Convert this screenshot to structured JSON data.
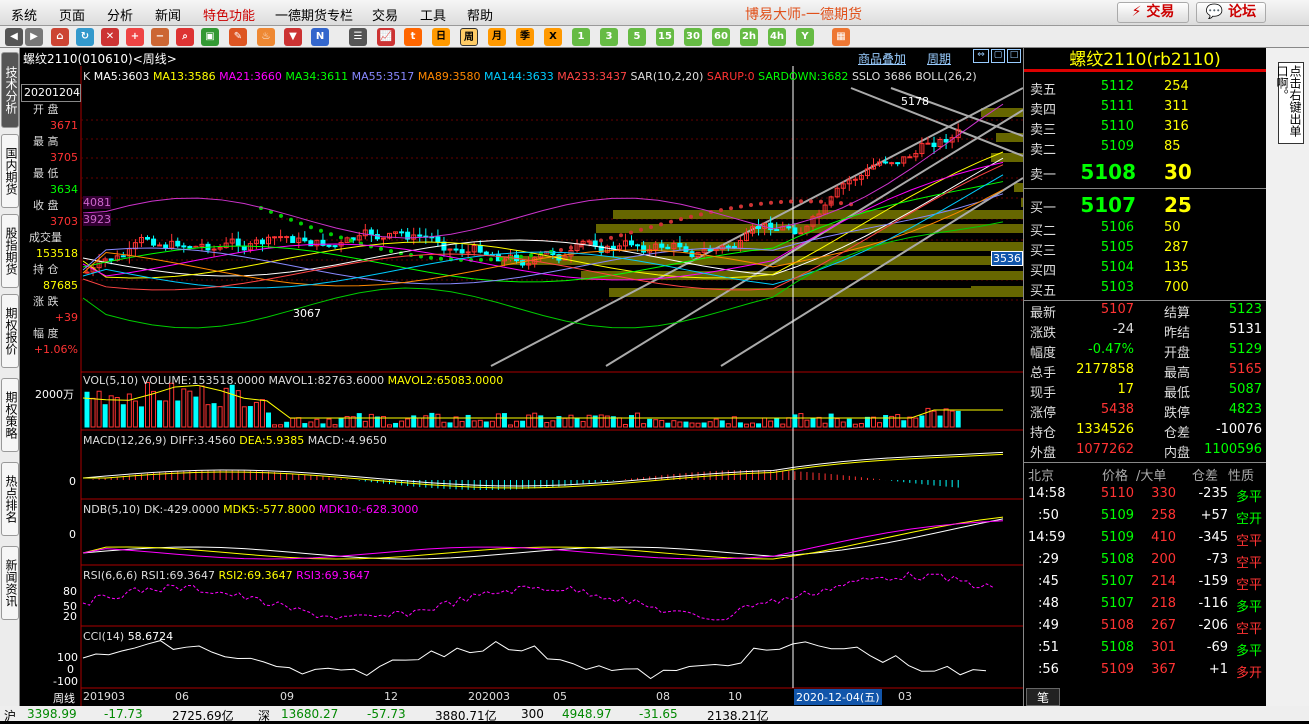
{
  "menu": [
    "系统",
    "页面",
    "分析",
    "新闻",
    "特色功能",
    "一德期货专栏",
    "交易",
    "工具",
    "帮助"
  ],
  "brand": "博易大师-一德期货",
  "btn_trade": "⚡ 交易",
  "btn_forum": "💬 论坛",
  "toolbar": {
    "periods": [
      "日",
      "周",
      "月",
      "季",
      "X",
      "1",
      "3",
      "5",
      "15",
      "30",
      "60",
      "2h",
      "4h",
      "Y"
    ]
  },
  "left_tabs": [
    "技术分析",
    "国内期货",
    "股指期货",
    "期权报价",
    "期权策略",
    "热点排名",
    "新闻资讯"
  ],
  "chart": {
    "title": "螺纹2110(010610)<周线>",
    "overlay_btn": "商品叠加",
    "period_btn": "周期",
    "ma_legend": [
      {
        "t": "K",
        "c": "#ddd"
      },
      {
        "t": "MA5:3603",
        "c": "#fff"
      },
      {
        "t": "MA13:3586",
        "c": "#ff0"
      },
      {
        "t": "MA21:3660",
        "c": "#f0f"
      },
      {
        "t": "MA34:3611",
        "c": "#0f0"
      },
      {
        "t": "MA55:3517",
        "c": "#88f"
      },
      {
        "t": "MA89:3580",
        "c": "#f80"
      },
      {
        "t": "MA144:3633",
        "c": "#0cf"
      },
      {
        "t": "MA233:3437",
        "c": "#f44"
      },
      {
        "t": "SAR(10,2,20)",
        "c": "#ddd"
      },
      {
        "t": "SARUP:0",
        "c": "#f33"
      },
      {
        "t": "SARDOWN:3682",
        "c": "#0f0"
      },
      {
        "t": "SSLO 3686",
        "c": "#ddd"
      },
      {
        "t": "BOLL(26,2)",
        "c": "#ddd"
      }
    ],
    "info": {
      "date": "20201204",
      "open_l": "开 盘",
      "open": "3671",
      "high_l": "最 高",
      "high": "3705",
      "low_l": "最 低",
      "low": "3634",
      "close_l": "收 盘",
      "close": "3703",
      "vol_l": "成交量",
      "vol": "153518",
      "oi_l": "持 仓",
      "oi": "87685",
      "chg_l": "涨 跌",
      "chg": "+39",
      "pct_l": "幅 度",
      "pct": "+1.06%",
      "axis1": "4081",
      "axis2": "3923"
    },
    "hi_label": "5178",
    "lo_label": "3067",
    "price_tag": "3536",
    "vol_legend": [
      {
        "t": "VOL(5,10)",
        "c": "#ddd"
      },
      {
        "t": "VOLUME:153518.0000",
        "c": "#ddd"
      },
      {
        "t": "MAVOL1:82763.6000",
        "c": "#ddd"
      },
      {
        "t": "MAVOL2:65083.0000",
        "c": "#ff0"
      }
    ],
    "vol_axis": "2000万",
    "macd_legend": [
      {
        "t": "MACD(12,26,9)",
        "c": "#ddd"
      },
      {
        "t": "DIFF:3.4560",
        "c": "#ddd"
      },
      {
        "t": "DEA:5.9385",
        "c": "#ff0"
      },
      {
        "t": "MACD:-4.9650",
        "c": "#ddd"
      }
    ],
    "macd_axis": "0",
    "ndb_legend": [
      {
        "t": "NDB(5,10)",
        "c": "#ddd"
      },
      {
        "t": "DK:-429.0000",
        "c": "#ddd"
      },
      {
        "t": "MDK5:-577.8000",
        "c": "#ff0"
      },
      {
        "t": "MDK10:-628.3000",
        "c": "#f0f"
      }
    ],
    "ndb_axis": "0",
    "rsi_legend": [
      {
        "t": "RSI(6,6,6)",
        "c": "#ddd"
      },
      {
        "t": "RSI1:69.3647",
        "c": "#ddd"
      },
      {
        "t": "RSI2:69.3647",
        "c": "#ff0"
      },
      {
        "t": "RSI3:69.3647",
        "c": "#f0f"
      }
    ],
    "rsi_axis": [
      "80",
      "50",
      "20"
    ],
    "cci_legend": [
      {
        "t": "CCI(14)",
        "c": "#ddd"
      },
      {
        "t": "58.6724",
        "c": "#fff"
      }
    ],
    "cci_axis": [
      "100",
      "0",
      "-100"
    ],
    "x_label": "周线",
    "x_ticks": [
      "201903",
      "06",
      "09",
      "12",
      "202003",
      "05",
      "08",
      "10",
      "03"
    ],
    "cursor_date": "2020-12-04(五)"
  },
  "quote": {
    "title": "螺纹2110(rb2110)",
    "asks": [
      {
        "l": "卖五",
        "p": "5112",
        "v": "254"
      },
      {
        "l": "卖四",
        "p": "5111",
        "v": "311"
      },
      {
        "l": "卖三",
        "p": "5110",
        "v": "316"
      },
      {
        "l": "卖二",
        "p": "5109",
        "v": "85"
      }
    ],
    "ask1": {
      "l": "卖一",
      "p": "5108",
      "v": "30"
    },
    "bid1": {
      "l": "买一",
      "p": "5107",
      "v": "25"
    },
    "bids": [
      {
        "l": "买二",
        "p": "5106",
        "v": "50"
      },
      {
        "l": "买三",
        "p": "5105",
        "v": "287"
      },
      {
        "l": "买四",
        "p": "5104",
        "v": "135"
      },
      {
        "l": "买五",
        "p": "5103",
        "v": "700"
      }
    ],
    "stats": [
      {
        "l1": "最新",
        "v1": "5107",
        "c1": "#f33",
        "l2": "结算",
        "v2": "5123",
        "c2": "#0f0"
      },
      {
        "l1": "涨跌",
        "v1": "-24",
        "c1": "#ddd",
        "l2": "昨结",
        "v2": "5131",
        "c2": "#fff"
      },
      {
        "l1": "幅度",
        "v1": "-0.47%",
        "c1": "#0f0",
        "l2": "开盘",
        "v2": "5129",
        "c2": "#0f0"
      },
      {
        "l1": "总手",
        "v1": "2177858",
        "c1": "#ff0",
        "l2": "最高",
        "v2": "5165",
        "c2": "#f33"
      },
      {
        "l1": "现手",
        "v1": "17",
        "c1": "#ff0",
        "l2": "最低",
        "v2": "5087",
        "c2": "#0f0"
      },
      {
        "l1": "涨停",
        "v1": "5438",
        "c1": "#f33",
        "l2": "跌停",
        "v2": "4823",
        "c2": "#0f0"
      },
      {
        "l1": "持仓",
        "v1": "1334526",
        "c1": "#ff0",
        "l2": "仓差",
        "v2": "-10076",
        "c2": "#fff"
      },
      {
        "l1": "外盘",
        "v1": "1077262",
        "c1": "#f33",
        "l2": "内盘",
        "v2": "1100596",
        "c2": "#0f0"
      }
    ],
    "tick_header": [
      "北京",
      "价格",
      "/大单",
      "仓差",
      "性质"
    ],
    "ticks": [
      {
        "t": "14:58",
        "p": "5110",
        "pc": "#f33",
        "v": "330",
        "d": "-235",
        "n": "多平",
        "nc": "#0f0"
      },
      {
        "t": ":50",
        "p": "5109",
        "pc": "#0f0",
        "v": "258",
        "d": "+57",
        "n": "空开",
        "nc": "#0f0"
      },
      {
        "t": "14:59",
        "p": "5109",
        "pc": "#0f0",
        "v": "410",
        "d": "-345",
        "n": "空平",
        "nc": "#f33"
      },
      {
        "t": ":29",
        "p": "5108",
        "pc": "#0f0",
        "v": "200",
        "d": "-73",
        "n": "空平",
        "nc": "#f33"
      },
      {
        "t": ":45",
        "p": "5107",
        "pc": "#0f0",
        "v": "214",
        "d": "-159",
        "n": "空平",
        "nc": "#f33"
      },
      {
        "t": ":48",
        "p": "5107",
        "pc": "#0f0",
        "v": "218",
        "d": "-116",
        "n": "多平",
        "nc": "#0f0"
      },
      {
        "t": ":49",
        "p": "5108",
        "pc": "#f33",
        "v": "267",
        "d": "-206",
        "n": "空平",
        "nc": "#f33"
      },
      {
        "t": ":51",
        "p": "5108",
        "pc": "#0f0",
        "v": "301",
        "d": "-69",
        "n": "多平",
        "nc": "#0f0"
      },
      {
        "t": ":56",
        "p": "5109",
        "pc": "#f33",
        "v": "367",
        "d": "+1",
        "n": "多开",
        "nc": "#f33"
      }
    ],
    "bottom_tab": "笔"
  },
  "right_panel": "点击右键出单口啊。",
  "status": [
    {
      "t": "沪",
      "c": "#000"
    },
    {
      "t": "3398.99",
      "c": "#080"
    },
    {
      "t": "-17.73",
      "c": "#080"
    },
    {
      "t": "2725.69亿",
      "c": "#000"
    },
    {
      "t": "深",
      "c": "#000"
    },
    {
      "t": "13680.27",
      "c": "#080"
    },
    {
      "t": "-57.73",
      "c": "#080"
    },
    {
      "t": "3880.71亿",
      "c": "#000"
    },
    {
      "t": "300",
      "c": "#000"
    },
    {
      "t": "4948.97",
      "c": "#080"
    },
    {
      "t": "-31.65",
      "c": "#080"
    },
    {
      "t": "2138.21亿",
      "c": "#000"
    }
  ]
}
